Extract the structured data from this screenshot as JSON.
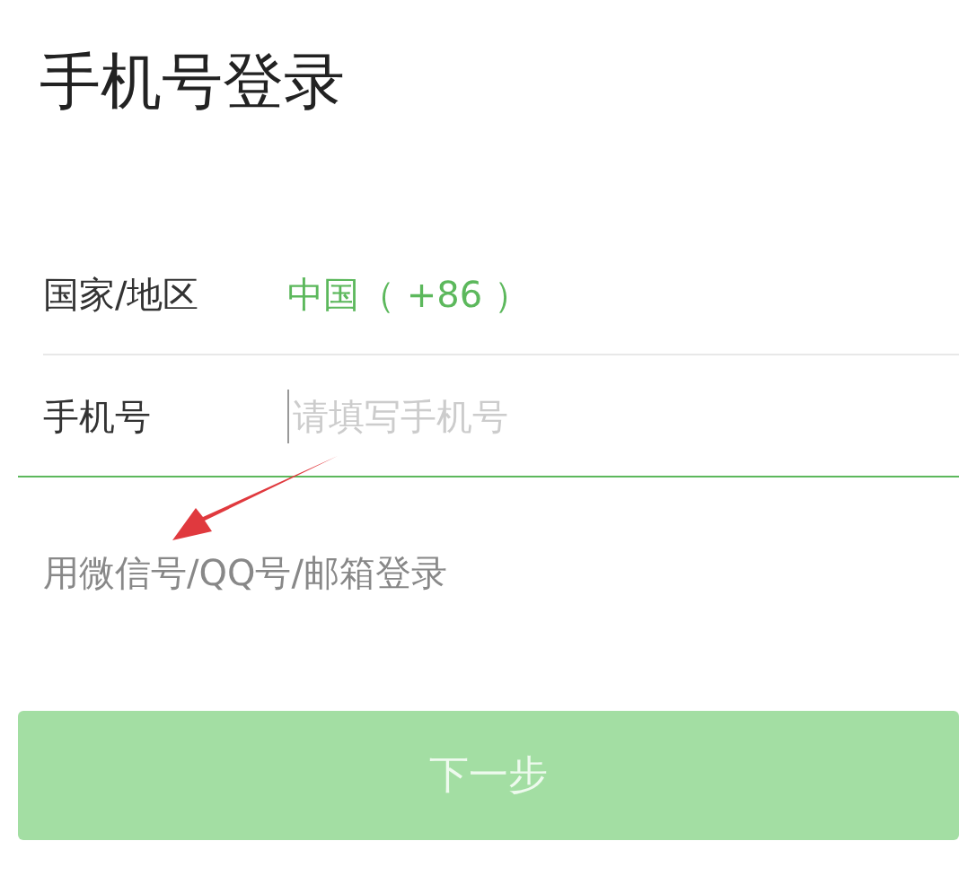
{
  "title": "手机号登录",
  "rows": [
    {
      "label": "国家/地区",
      "kind": "value",
      "value": "中国（ +86 ）"
    },
    {
      "label": "手机号",
      "kind": "input",
      "placeholder": "请填写手机号",
      "focused": true
    }
  ],
  "alt_login": "用微信号/QQ号/邮箱登录",
  "next_button": {
    "label": "下一步",
    "disabled": true
  }
}
